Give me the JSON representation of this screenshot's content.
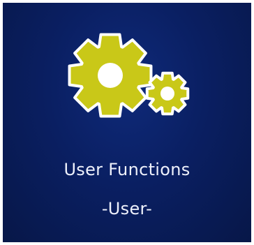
{
  "tile": {
    "icon": "gears-icon",
    "title": "User Functions",
    "subtitle": "-User-",
    "colors": {
      "background": "#0a1f62",
      "gear_fill": "#c9c818",
      "gear_outline": "#ffffff",
      "text": "#eef1fb"
    }
  }
}
